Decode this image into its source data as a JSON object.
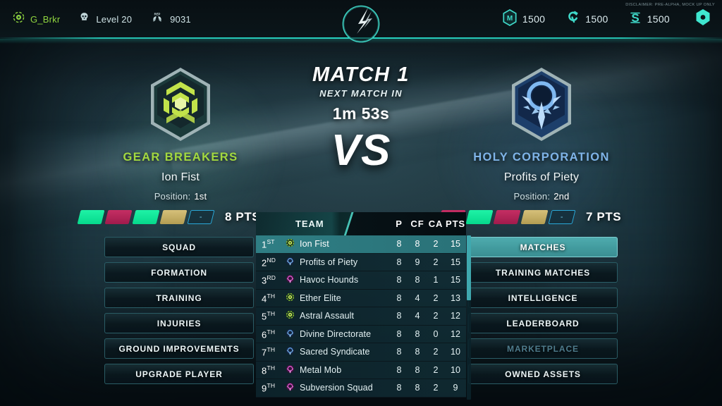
{
  "topbar": {
    "player": {
      "icon": "faction-emblem-icon",
      "name": "G_Brkr"
    },
    "level": {
      "icon": "skull-icon",
      "label": "Level 20"
    },
    "reputation": {
      "icon": "rep-laurel-icon",
      "value": "9031"
    },
    "currencies": [
      {
        "icon": "m-token-icon",
        "name": "matter",
        "value": "1500"
      },
      {
        "icon": "c-token-icon",
        "name": "credits",
        "value": "1500"
      },
      {
        "icon": "s-token-icon",
        "name": "shards",
        "value": "1500"
      }
    ],
    "settings_icon": "hex-settings-icon",
    "center_logo_icon": "lightning-circle-logo-icon",
    "disclaimer": "DISCLAIMER: PRE-ALPHA, MOCK UP ONLY"
  },
  "match": {
    "title": "MATCH 1",
    "subtitle": "NEXT MATCH IN",
    "timer": "1m 53s",
    "vs_label": "VS"
  },
  "teams": {
    "left": {
      "crest_icon": "gear-breakers-crest-icon",
      "faction": "GEAR BREAKERS",
      "faction_color": "#a3d93f",
      "club": "Ion Fist",
      "position_label": "Position:",
      "position_value": "1st",
      "form": [
        "win",
        "loss",
        "win",
        "draw",
        "none"
      ],
      "form_placeholder": "-",
      "points": "8 PTS"
    },
    "right": {
      "crest_icon": "holy-corporation-crest-icon",
      "faction": "HOLY CORPORATION",
      "faction_color": "#7fb4e8",
      "club": "Profits of Piety",
      "position_label": "Position:",
      "position_value": "2nd",
      "form": [
        "loss",
        "win",
        "loss",
        "draw",
        "none"
      ],
      "form_placeholder": "-",
      "points": "7 PTS"
    }
  },
  "left_menu": [
    {
      "label": "SQUAD",
      "state": "normal"
    },
    {
      "label": "FORMATION",
      "state": "normal"
    },
    {
      "label": "TRAINING",
      "state": "normal"
    },
    {
      "label": "INJURIES",
      "state": "normal"
    },
    {
      "label": "GROUND IMPROVEMENTS",
      "state": "normal"
    },
    {
      "label": "UPGRADE PLAYER",
      "state": "normal"
    }
  ],
  "right_menu": [
    {
      "label": "MATCHES",
      "state": "active"
    },
    {
      "label": "TRAINING MATCHES",
      "state": "normal"
    },
    {
      "label": "INTELLIGENCE",
      "state": "normal"
    },
    {
      "label": "LEADERBOARD",
      "state": "normal"
    },
    {
      "label": "MARKETPLACE",
      "state": "disabled"
    },
    {
      "label": "OWNED ASSETS",
      "state": "normal"
    }
  ],
  "standings": {
    "columns": [
      "",
      "TEAM",
      "P",
      "CF",
      "CA",
      "PTS"
    ],
    "rows": [
      {
        "rank": "1",
        "suffix": "st",
        "team": "Ion Fist",
        "faction": "green",
        "p": "8",
        "cf": "8",
        "ca": "2",
        "pts": "15",
        "highlight": true
      },
      {
        "rank": "2",
        "suffix": "nd",
        "team": "Profits of Piety",
        "faction": "blue",
        "p": "8",
        "cf": "9",
        "ca": "2",
        "pts": "15",
        "highlight": false
      },
      {
        "rank": "3",
        "suffix": "rd",
        "team": "Havoc Hounds",
        "faction": "magenta",
        "p": "8",
        "cf": "8",
        "ca": "1",
        "pts": "15",
        "highlight": false
      },
      {
        "rank": "4",
        "suffix": "TH",
        "team": "Ether Elite",
        "faction": "green",
        "p": "8",
        "cf": "4",
        "ca": "2",
        "pts": "13",
        "highlight": false
      },
      {
        "rank": "5",
        "suffix": "TH",
        "team": "Astral Assault",
        "faction": "green",
        "p": "8",
        "cf": "4",
        "ca": "2",
        "pts": "12",
        "highlight": false
      },
      {
        "rank": "6",
        "suffix": "TH",
        "team": "Divine Directorate",
        "faction": "blue",
        "p": "8",
        "cf": "8",
        "ca": "0",
        "pts": "12",
        "highlight": false
      },
      {
        "rank": "7",
        "suffix": "TH",
        "team": "Sacred Syndicate",
        "faction": "blue",
        "p": "8",
        "cf": "8",
        "ca": "2",
        "pts": "10",
        "highlight": false
      },
      {
        "rank": "8",
        "suffix": "TH",
        "team": "Metal Mob",
        "faction": "magenta",
        "p": "8",
        "cf": "8",
        "ca": "2",
        "pts": "10",
        "highlight": false
      },
      {
        "rank": "9",
        "suffix": "TH",
        "team": "Subversion Squad",
        "faction": "magenta",
        "p": "8",
        "cf": "8",
        "ca": "2",
        "pts": "9",
        "highlight": false
      }
    ],
    "scroll_percent": 0
  },
  "colors": {
    "accent_teal": "#3fd0c4",
    "accent_green": "#a3d93f",
    "accent_blue": "#7fb4e8",
    "accent_magenta": "#e84bd6",
    "win": "#06d98c",
    "loss": "#c52e63",
    "draw": "#b39d52",
    "background": "#16262e"
  }
}
